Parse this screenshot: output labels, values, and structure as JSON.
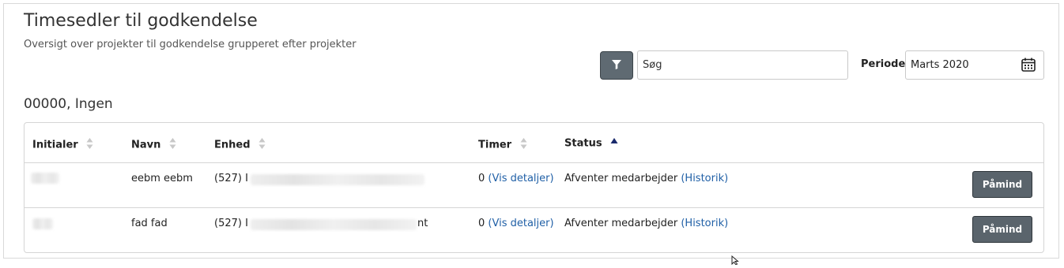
{
  "page": {
    "title": "Timesedler til godkendelse",
    "subtitle": "Oversigt over projekter til godkendelse grupperet efter projekter"
  },
  "toolbar": {
    "filter_icon": "filter-icon",
    "search_value": "Søg",
    "periode_label": "Periode",
    "periode_value": "Marts 2020",
    "calendar_icon": "calendar-icon"
  },
  "group": {
    "heading": "00000, Ingen"
  },
  "table": {
    "columns": [
      {
        "label": "Initialer",
        "sort": "none"
      },
      {
        "label": "Navn",
        "sort": "none"
      },
      {
        "label": "Enhed",
        "sort": "none"
      },
      {
        "label": "Timer",
        "sort": "none"
      },
      {
        "label": "Status",
        "sort": "ascending"
      }
    ],
    "rows": [
      {
        "initialer": "",
        "navn": "eebm eebm",
        "enhed_prefix": "(527) I",
        "enhed_suffix": "",
        "timer": "0",
        "timer_link": "(Vis detaljer)",
        "status": "Afventer medarbejder",
        "status_link": "(Historik)",
        "action": "Påmind"
      },
      {
        "initialer": "",
        "navn": "fad fad",
        "enhed_prefix": "(527) I",
        "enhed_suffix": "nt",
        "timer": "0",
        "timer_link": "(Vis detaljer)",
        "status": "Afventer medarbejder",
        "status_link": "(Historik)",
        "action": "Påmind"
      }
    ]
  },
  "colors": {
    "link": "#1f5fa6",
    "button_bg": "#5a646c",
    "sort_active": "#1a2a6c"
  }
}
